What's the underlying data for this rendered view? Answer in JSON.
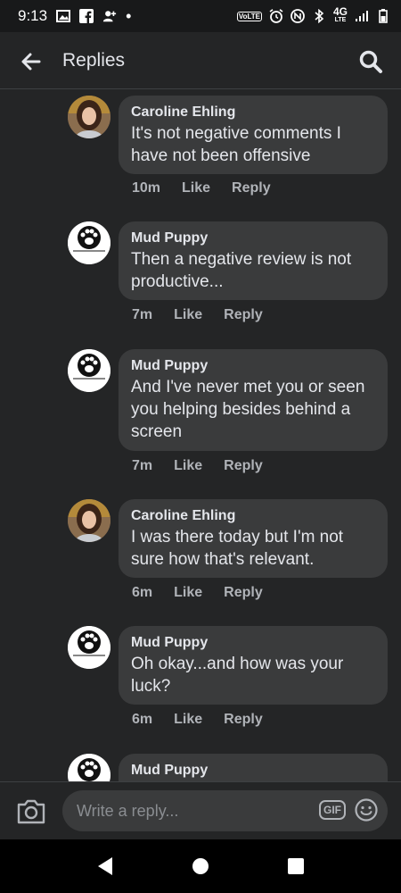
{
  "status_bar": {
    "time": "9:13",
    "network": "4G",
    "network_sub": "LTE",
    "volte": "VoLTE"
  },
  "header": {
    "title": "Replies"
  },
  "comments": [
    {
      "author": "Caroline Ehling",
      "text": "It's not negative comments I have not been offensive",
      "time": "10m",
      "like": "Like",
      "reply": "Reply",
      "avatar": "caroline-avatar"
    },
    {
      "author": "Mud Puppy",
      "text": "Then a negative review is not productive...",
      "time": "7m",
      "like": "Like",
      "reply": "Reply",
      "avatar": "mud-puppy-logo"
    },
    {
      "author": "Mud Puppy",
      "text": "And I've never met you or seen you helping besides behind a screen",
      "time": "7m",
      "like": "Like",
      "reply": "Reply",
      "avatar": "mud-puppy-logo"
    },
    {
      "author": "Caroline Ehling",
      "text": "I was there today but I'm not sure how that's relevant.",
      "time": "6m",
      "like": "Like",
      "reply": "Reply",
      "avatar": "caroline-avatar"
    },
    {
      "author": "Mud Puppy",
      "text": "Oh okay...and how was your luck?",
      "time": "6m",
      "like": "Like",
      "reply": "Reply",
      "avatar": "mud-puppy-logo"
    },
    {
      "author": "Mud Puppy",
      "avatar": "mud-puppy-logo"
    }
  ],
  "composer": {
    "placeholder": "Write a reply...",
    "gif_label": "GIF"
  },
  "colors": {
    "background": "#18191a",
    "surface": "#242526",
    "bubble": "#3a3b3c",
    "text": "#e4e6eb",
    "muted": "#b0b3b8"
  }
}
